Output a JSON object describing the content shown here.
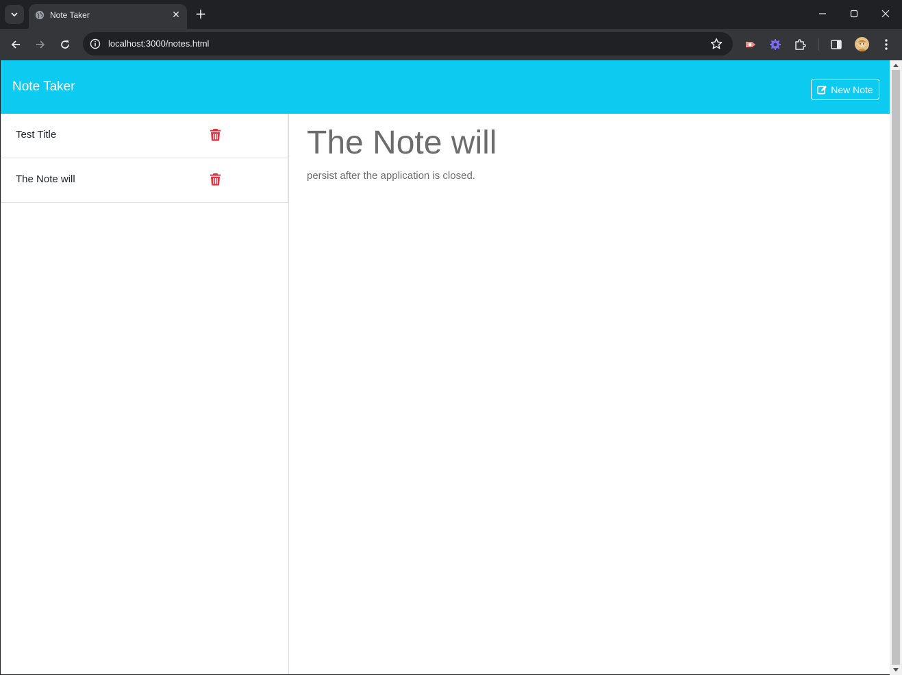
{
  "browser": {
    "tab_title": "Note Taker",
    "url": "localhost:3000/notes.html"
  },
  "app": {
    "brand": "Note Taker",
    "new_note_label": "New Note",
    "accent_color": "#0dcaf0",
    "delete_color": "#dc3545"
  },
  "notes": [
    {
      "title": "Test Title"
    },
    {
      "title": "The Note will"
    }
  ],
  "active_note": {
    "title": "The Note will",
    "text": "persist after the application is closed."
  }
}
